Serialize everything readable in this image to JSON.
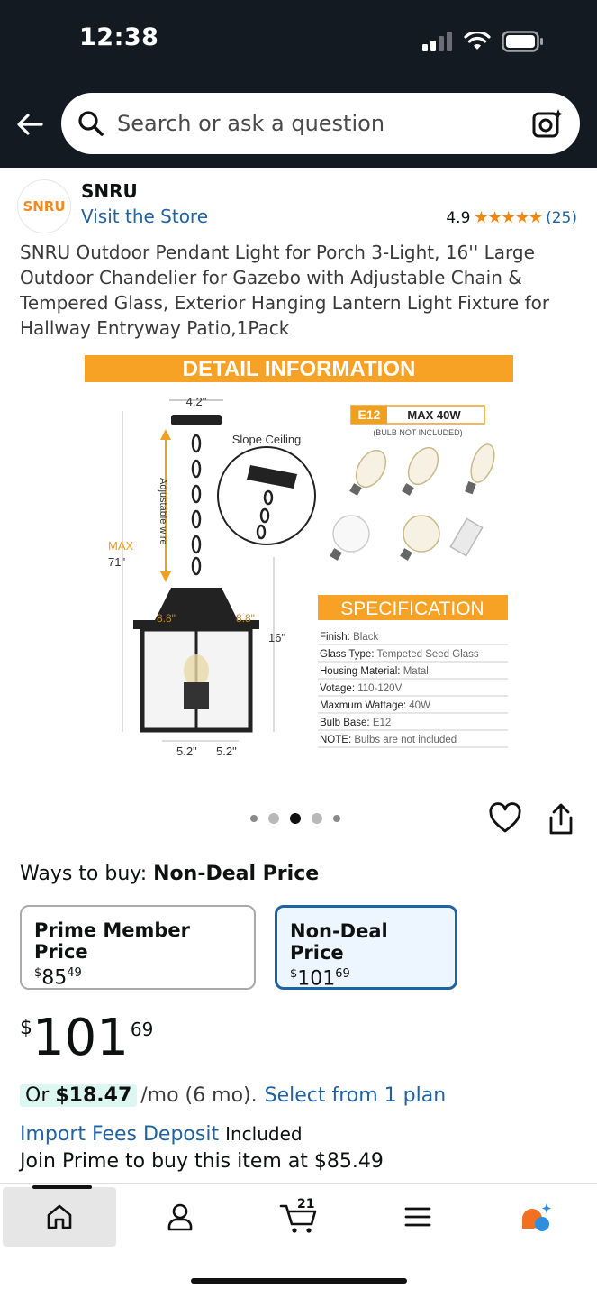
{
  "status_bar": {
    "time": "12:38",
    "icons": [
      "signal-icon",
      "wifi-icon",
      "battery-icon"
    ]
  },
  "search": {
    "placeholder": "Search or ask a question"
  },
  "brand": {
    "logo_text": "SNRU",
    "name": "SNRU",
    "store_link": "Visit the Store",
    "rating": "4.9",
    "stars": "★★★★★",
    "review_count": "(25)"
  },
  "product": {
    "title": "SNRU Outdoor Pendant Light for Porch 3-Light, 16'' Large Outdoor Chandelier for Gazebo with Adjustable Chain & Tempered Glass, Exterior Hanging Lantern Light Fixture for Hallway Entryway Patio,1Pack"
  },
  "image": {
    "banner": "DETAIL INFORMATION",
    "dim_top": "4.2\"",
    "slope": "Slope Ceiling",
    "adjustable": "Adjustable wire",
    "max": "MAX",
    "max_val": "71\"",
    "height": "16\"",
    "width_left": "8.8\"",
    "width_right": "8.8\"",
    "base_left": "5.2\"",
    "base_right": "5.2\"",
    "bulb_type": "E12",
    "bulb_max": "MAX 40W",
    "bulb_note": "(BULB NOT INCLUDED)",
    "spec_title": "SPECIFICATION",
    "specs": [
      {
        "k": "Finish:",
        "v": "Black"
      },
      {
        "k": "Glass Type:",
        "v": "Tempeted Seed Glass"
      },
      {
        "k": "Housing Material:",
        "v": "Matal"
      },
      {
        "k": "Votage:",
        "v": "110-120V"
      },
      {
        "k": "Maxmum Wattage:",
        "v": "40W"
      },
      {
        "k": "Bulb Base:",
        "v": "E12"
      },
      {
        "k": "NOTE:",
        "v": "Bulbs are not included"
      }
    ]
  },
  "buy": {
    "ways_label": "Ways to buy:",
    "ways_value": "Non-Deal Price",
    "prime_label": "Prime Member Price",
    "prime_cur": "$",
    "prime_whole": "85",
    "prime_frac": "49",
    "nondeal_label": "Non-Deal Price",
    "nondeal_cur": "$",
    "nondeal_whole": "101",
    "nondeal_frac": "69",
    "price_cur": "$",
    "price_whole": "101",
    "price_frac": "69",
    "installment_prefix": "Or ",
    "installment_amount": "$18.47",
    "installment_per": "/mo (6 mo).",
    "installment_link": "Select from 1 plan",
    "import_link": "Import Fees Deposit",
    "import_status": "Included",
    "join_prime": "Join Prime to buy this item at $85.49"
  },
  "bottom_nav": {
    "cart_count": "21"
  }
}
